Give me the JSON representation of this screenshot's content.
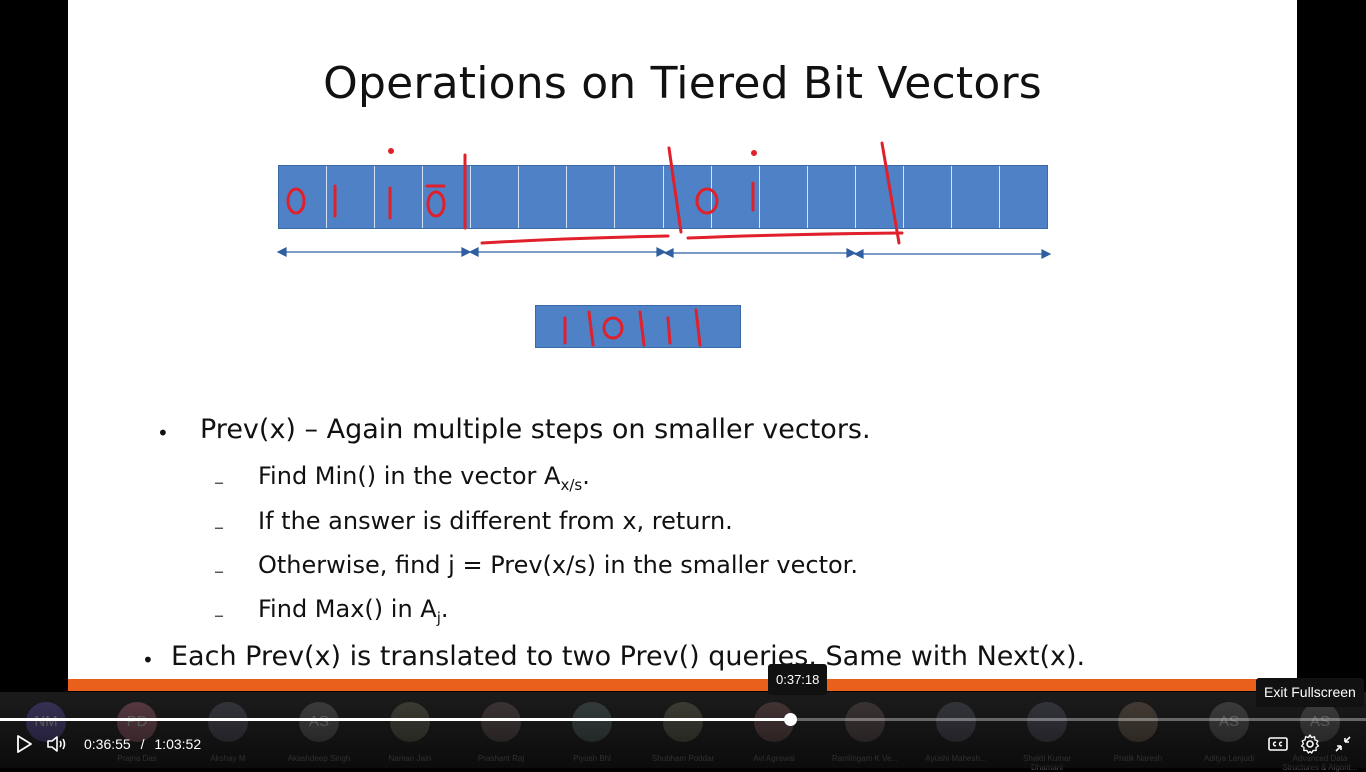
{
  "slide": {
    "title": "Operations on Tiered Bit Vectors",
    "bullet1": "Prev(x) – Again multiple steps on smaller vectors.",
    "sub1_main": "Find Min() in the vector A",
    "sub1_sub": "x/s",
    "sub1_tail": ".",
    "sub2": "If the answer is different from x, return.",
    "sub3": "Otherwise, find j = Prev(x/s) in the smaller vector.",
    "sub4_main": "Find Max() in A",
    "sub4_sub": "j",
    "sub4_tail": ".",
    "bullet2": "Each Prev(x) is translated to two Prev() queries. Same with Next(x).",
    "bullet_glyph": "•",
    "dash_glyph": "–",
    "bitvec_cells": 16,
    "smallvec_cells": 4,
    "ink_color": "#e0202a",
    "accent_color": "#e8601c"
  },
  "participants": [
    {
      "initials": "NM",
      "name": "",
      "color": "#5b4ea0"
    },
    {
      "initials": "PD",
      "name": "Prajna Das",
      "color": "#a06070"
    },
    {
      "initials": "",
      "name": "Akshay M",
      "color": "#556"
    },
    {
      "initials": "AS",
      "name": "Akashdeep Singh",
      "color": "#666"
    },
    {
      "initials": "",
      "name": "Naman Jain",
      "color": "#665"
    },
    {
      "initials": "",
      "name": "Prashant Raj",
      "color": "#655"
    },
    {
      "initials": "",
      "name": "Piyush Bhl",
      "color": "#566"
    },
    {
      "initials": "",
      "name": "Shubham Poddar",
      "color": "#665"
    },
    {
      "initials": "",
      "name": "Avi Agrawal",
      "color": "#755"
    },
    {
      "initials": "",
      "name": "Ramlingam K Ve...",
      "color": "#655"
    },
    {
      "initials": "",
      "name": "Ayushi Mahesh...",
      "color": "#556"
    },
    {
      "initials": "",
      "name": "Shakti Kumar Dhamani",
      "color": "#556"
    },
    {
      "initials": "",
      "name": "Pratik Naresh",
      "color": "#765"
    },
    {
      "initials": "AS",
      "name": "Aditya Lanjudi",
      "color": "#666"
    },
    {
      "initials": "AS",
      "name": "Advanced Data Structures & Algorit...",
      "color": "#666"
    }
  ],
  "player": {
    "current_time": "0:36:55",
    "separator": "/",
    "duration": "1:03:52",
    "progress": 0.578,
    "hover_time": "0:37:18",
    "exit_fullscreen_label": "Exit Fullscreen",
    "play_icon": "play-icon",
    "volume_icon": "volume-icon",
    "cc_icon": "captions-icon",
    "settings_icon": "settings-gear-icon",
    "exit_icon": "exit-fullscreen-icon"
  }
}
